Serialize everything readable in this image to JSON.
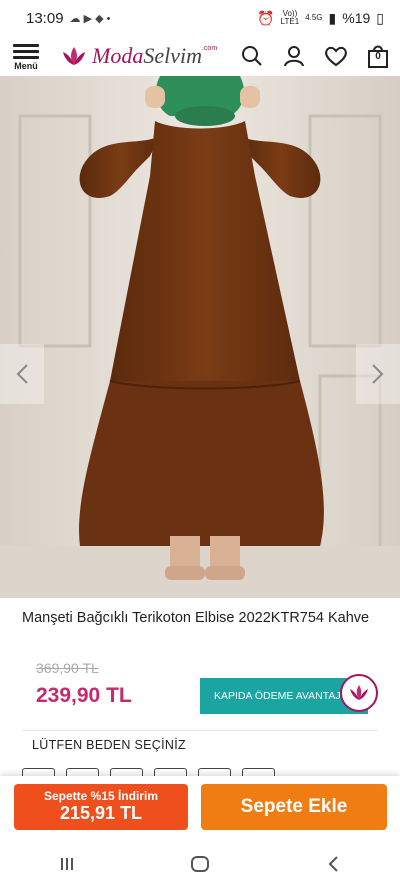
{
  "status_bar": {
    "time": "13:09",
    "network_top": "Vo))",
    "network_bottom": "LTE1",
    "signal_label": "4.5G",
    "battery": "%19"
  },
  "header": {
    "menu_label": "Menü",
    "brand_part1": "Moda",
    "brand_part2": "Selvim",
    "brand_suffix": ".com",
    "cart_count": "0"
  },
  "product": {
    "title": "Manşeti Bağcıklı Terikoton Elbise 2022KTR754 Kahve",
    "old_price": "369,90 TL",
    "price": "239,90 TL",
    "cod_button": "KAPIDA ÖDEME AVANTAJI",
    "size_label": "LÜTFEN BEDEN SEÇİNİZ"
  },
  "bottom_bar": {
    "discount_line1": "Sepette %15 İndirim",
    "discount_price": "215,91 TL",
    "add_to_cart": "Sepete Ekle"
  },
  "colors": {
    "brand": "#a3155c",
    "price": "#c7296e",
    "cod": "#1aa5a3",
    "discount": "#ef4f1d",
    "add_to_cart": "#f07c14",
    "dress": "#6e3512"
  }
}
